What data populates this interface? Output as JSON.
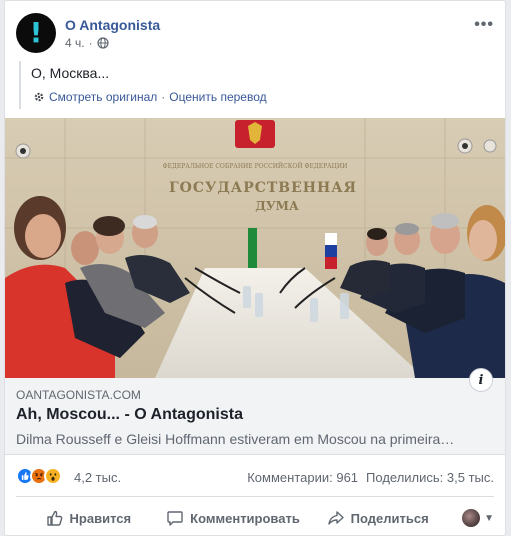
{
  "post": {
    "page_name": "O Antagonista",
    "time": "4 ч.",
    "privacy_icon": "globe-icon",
    "more_label": "•••",
    "avatar_symbol": "!",
    "translated_text": "О, Москва...",
    "see_original": "Смотреть оригинал",
    "separator": "·",
    "rate_translation": "Оценить перевод"
  },
  "link_preview": {
    "domain": "OANTAGONISTA.COM",
    "title": "Ah, Moscou... - O Antagonista",
    "description": "Dilma Rousseff e Gleisi Hoffmann estiveram em Moscou na primeira…",
    "photo_sign_small": "ФЕДЕРАЛЬНОЕ СОБРАНИЕ\nРОССИЙСКОЙ ФЕДЕРАЦИИ",
    "photo_sign_main": "ГОСУДАРСТВЕННАЯ",
    "photo_sign_sub": "ДУМА",
    "info_label": "i"
  },
  "stats": {
    "reactions": [
      "like",
      "angry",
      "wow"
    ],
    "reaction_count": "4,2 тыс.",
    "comments": "Комментарии: 961",
    "shares": "Поделились: 3,5 тыс."
  },
  "actions": {
    "like": "Нравится",
    "comment": "Комментировать",
    "share": "Поделиться"
  },
  "colors": {
    "link_blue": "#385898",
    "like_blue": "#1877f2",
    "angry_orange": "#e9710f",
    "wow_yellow": "#f7b125",
    "avatar_accent": "#2ec4d8"
  }
}
